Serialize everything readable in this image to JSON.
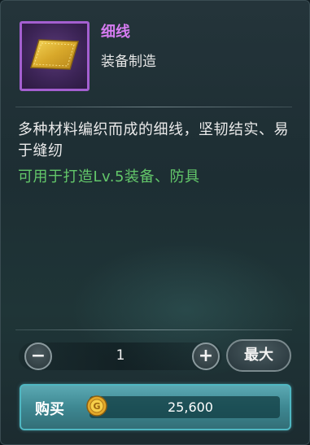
{
  "item": {
    "name": "细线",
    "category": "装备制造",
    "icon": "gold-thread-icon",
    "rarity_color": "#a45fd0"
  },
  "description": {
    "text": "多种材料编织而成的细线，坚韧结实、易于缝纫",
    "use": "可用于打造Lv.5装备、防具"
  },
  "quantity": {
    "decrease_icon": "minus-icon",
    "value": "1",
    "increase_icon": "plus-icon",
    "max_label": "最大"
  },
  "purchase": {
    "label": "购买",
    "currency_icon": "gold-coin-icon",
    "price": "25,600"
  },
  "colors": {
    "item_name": "#d77cf2",
    "use_text": "#63c76a",
    "buy_button": "#3e8892"
  }
}
